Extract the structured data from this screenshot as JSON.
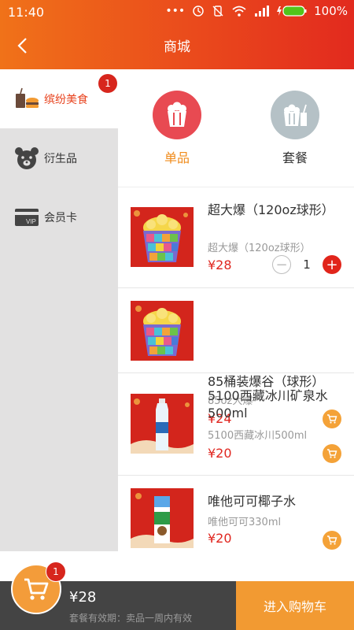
{
  "status_bar": {
    "time": "11:40",
    "battery": "100%"
  },
  "header": {
    "title": "商城"
  },
  "sidebar": {
    "items": [
      {
        "label": "缤纷美食",
        "icon": "food-drink-icon",
        "badge": "1",
        "active": true
      },
      {
        "label": "衍生品",
        "icon": "bear-icon"
      },
      {
        "label": "会员卡",
        "icon": "vip-card-icon"
      }
    ]
  },
  "category_tabs": [
    {
      "label": "单品",
      "icon": "popcorn-icon",
      "active": true
    },
    {
      "label": "套餐",
      "icon": "combo-meal-icon"
    }
  ],
  "products": [
    {
      "name": "超大爆（120oz球形）",
      "desc": "超大爆（120oz球形）",
      "price": "¥28",
      "qty": "1"
    },
    {
      "name": "85桶装爆谷（球形）",
      "desc": "85oz大爆",
      "price": "¥24"
    },
    {
      "name": "5100西藏冰川矿泉水500ml",
      "desc": "5100西藏冰川500ml",
      "price": "¥20"
    },
    {
      "name": "唯他可可椰子水",
      "desc": "唯他可可330ml",
      "price": "¥20"
    }
  ],
  "cart": {
    "badge": "1",
    "total": "¥28",
    "validity": "套餐有效期：卖品一周内有效",
    "checkout_label": "进入购物车"
  },
  "colors": {
    "header_start": "#f07219",
    "header_end": "#e22a1e",
    "price": "#e0261f",
    "accent": "#f29a32"
  }
}
